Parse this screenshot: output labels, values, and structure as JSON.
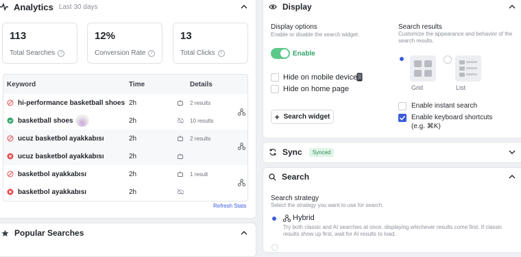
{
  "analytics": {
    "title": "Analytics",
    "subtitle": "Last 30 days",
    "stats": [
      {
        "value": "113",
        "label": "Total Searches"
      },
      {
        "value": "12%",
        "label": "Conversion Rate"
      },
      {
        "value": "13",
        "label": "Total Clicks"
      }
    ],
    "table": {
      "headers": [
        "Keyword",
        "Time",
        "Details"
      ],
      "rows": [
        {
          "keyword": "hi-performance basketball shoes",
          "status": "no-click",
          "time": "2h",
          "details": "2 results"
        },
        {
          "keyword": "basketball shoes",
          "status": "success",
          "time": "2h",
          "details": "10 results"
        },
        {
          "keyword": "ucuz basketbol ayakkabısı",
          "status": "no-click",
          "time": "2h",
          "details": "2 results"
        },
        {
          "keyword": "ucuz basketbol ayakkabısı",
          "status": "error",
          "time": "2h",
          "details": ""
        },
        {
          "keyword": "basketbol ayakkabısı",
          "status": "no-click",
          "time": "2h",
          "details": "1 result"
        },
        {
          "keyword": "basketbol ayakkabısı",
          "status": "error",
          "time": "2h",
          "details": ""
        }
      ]
    },
    "refresh_label": "Refresh Stats"
  },
  "popular": {
    "title": "Popular Searches"
  },
  "display": {
    "title": "Display",
    "options_title": "Display options",
    "options_desc": "Enable or disable the search widget.",
    "enable_label": "Enable",
    "hide_mobile": "Hide on mobile devices",
    "hide_home": "Hide on home page",
    "search_widget_btn": "Search widget",
    "results_title": "Search results",
    "results_desc": "Customize the appearance and behavior of the search results.",
    "grid_label": "Grid",
    "list_label": "List",
    "instant_label": "Enable instant search",
    "keyboard_label": "Enable keyboard shortcuts",
    "keyboard_hint": "(e.g. ⌘K)"
  },
  "sync": {
    "title": "Sync",
    "badge": "Synced"
  },
  "search": {
    "title": "Search",
    "strategy_title": "Search strategy",
    "strategy_desc": "Select the strategy you want to use for search.",
    "hybrid_label": "Hybrid",
    "hybrid_desc": "Try both classic and AI searches at once, displaying whichever results come first. If classic results show up first, wait for AI results to load."
  },
  "colors": {
    "accent": "#3b5bdb",
    "toggle": "#5cc98a",
    "error": "#e5484d",
    "success": "#30a46c"
  }
}
